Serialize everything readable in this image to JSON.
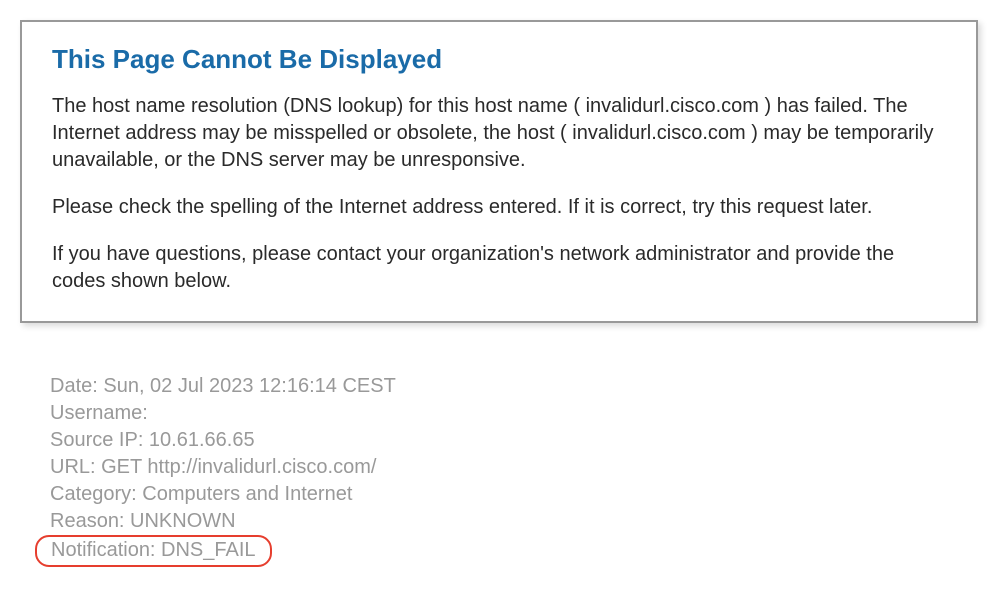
{
  "error": {
    "title": "This Page Cannot Be Displayed",
    "paragraph1": "The host name resolution (DNS lookup) for this host name ( invalidurl.cisco.com ) has failed. The Internet address may be misspelled or obsolete, the host ( invalidurl.cisco.com ) may be temporarily unavailable, or the DNS server may be unresponsive.",
    "paragraph2": "Please check the spelling of the Internet address entered. If it is correct, try this request later.",
    "paragraph3": "If you have questions, please contact your organization's network administrator and provide the codes shown below."
  },
  "details": {
    "date": "Date: Sun, 02 Jul 2023 12:16:14 CEST",
    "username": "Username:",
    "source_ip": "Source IP: 10.61.66.65",
    "url": "URL: GET http://invalidurl.cisco.com/",
    "category": "Category: Computers and Internet",
    "reason": "Reason: UNKNOWN",
    "notification": "Notification: DNS_FAIL"
  }
}
